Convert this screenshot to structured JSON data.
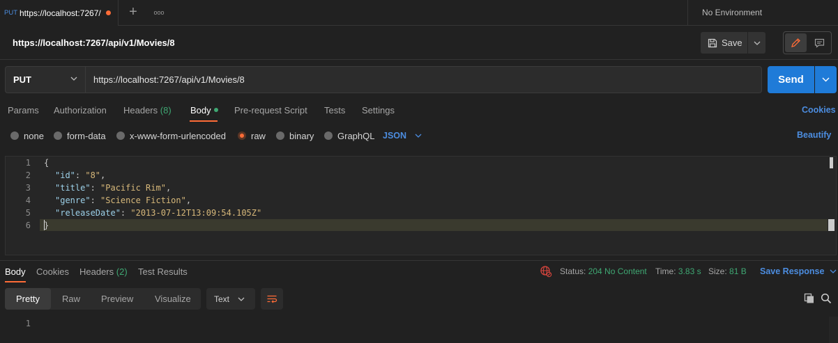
{
  "tab": {
    "method": "PUT",
    "title": "https://localhost:7267/",
    "unsaved": true
  },
  "tab_actions": {
    "add": "+",
    "more": "ooo"
  },
  "environment": "No Environment",
  "request": {
    "title": "https://localhost:7267/api/v1/Movies/8",
    "save_label": "Save",
    "method": "PUT",
    "url": "https://localhost:7267/api/v1/Movies/8",
    "send_label": "Send"
  },
  "request_tabs": [
    {
      "label": "Params"
    },
    {
      "label": "Authorization"
    },
    {
      "label": "Headers",
      "count": "(8)"
    },
    {
      "label": "Body"
    },
    {
      "label": "Pre-request Script"
    },
    {
      "label": "Tests"
    },
    {
      "label": "Settings"
    }
  ],
  "cookies_label": "Cookies",
  "body_types": [
    {
      "label": "none",
      "selected": false
    },
    {
      "label": "form-data",
      "selected": false
    },
    {
      "label": "x-www-form-urlencoded",
      "selected": false
    },
    {
      "label": "raw",
      "selected": true
    },
    {
      "label": "binary",
      "selected": false
    },
    {
      "label": "GraphQL",
      "selected": false
    }
  ],
  "body_format": "JSON",
  "beautify_label": "Beautify",
  "editor": {
    "line_numbers": [
      "1",
      "2",
      "3",
      "4",
      "5",
      "6"
    ],
    "open_brace": "{",
    "close_brace": "}",
    "fields": [
      {
        "key": "\"id\"",
        "value": "\"8\"",
        "sep": ": ",
        "end": ","
      },
      {
        "key": "\"title\"",
        "value": "\"Pacific Rim\"",
        "sep": ": ",
        "end": ","
      },
      {
        "key": "\"genre\"",
        "value": "\"Science Fiction\"",
        "sep": ": ",
        "end": ","
      },
      {
        "key": "\"releaseDate\"",
        "value": "\"2013-07-12T13:09:54.105Z\"",
        "sep": ": ",
        "end": ""
      }
    ]
  },
  "response_tabs": [
    {
      "label": "Body"
    },
    {
      "label": "Cookies"
    },
    {
      "label": "Headers",
      "count": "(2)"
    },
    {
      "label": "Test Results"
    }
  ],
  "response_meta": {
    "status_label": "Status:",
    "status_value": "204 No Content",
    "time_label": "Time:",
    "time_value": "3.83 s",
    "size_label": "Size:",
    "size_value": "81 B",
    "save_response": "Save Response"
  },
  "view_tabs": [
    {
      "label": "Pretty"
    },
    {
      "label": "Raw"
    },
    {
      "label": "Preview"
    },
    {
      "label": "Visualize"
    }
  ],
  "response_format": "Text",
  "response_line_numbers": [
    "1"
  ],
  "colors": {
    "accent": "#ff6c37",
    "link": "#4c8de0",
    "send": "#1f7bd8",
    "success": "#3fa873"
  }
}
